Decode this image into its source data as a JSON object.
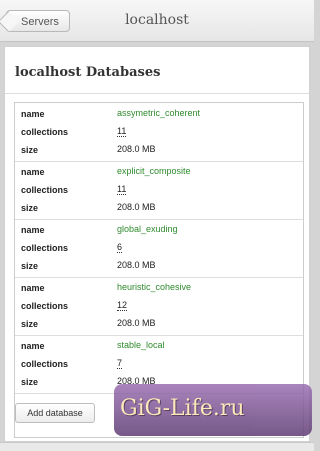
{
  "nav": {
    "back_label": "Servers",
    "title": "localhost"
  },
  "page": {
    "heading": "localhost Databases",
    "add_button_label": "Add database"
  },
  "labels": {
    "name": "name",
    "collections": "collections",
    "size": "size"
  },
  "databases": [
    {
      "name": "assymetric_coherent",
      "collections": "11",
      "size": "208.0 MB"
    },
    {
      "name": "explicit_composite",
      "collections": "11",
      "size": "208.0 MB"
    },
    {
      "name": "global_exuding",
      "collections": "6",
      "size": "208.0 MB"
    },
    {
      "name": "heuristic_cohesive",
      "collections": "12",
      "size": "208.0 MB"
    },
    {
      "name": "stable_local",
      "collections": "7",
      "size": "208.0 MB"
    }
  ],
  "watermark": "GiG-Life.ru"
}
